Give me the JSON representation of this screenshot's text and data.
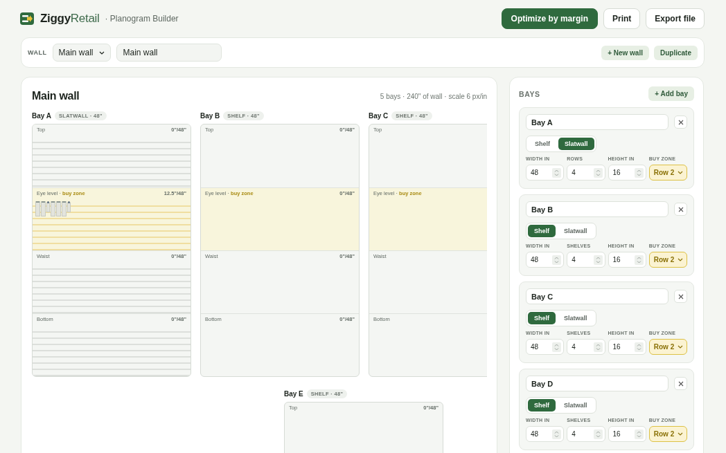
{
  "app": {
    "brand_bold": "Ziggy",
    "brand_light": "Retail",
    "subtitle": "· Planogram Builder"
  },
  "header_actions": [
    {
      "label": "Optimize by margin",
      "kind": "primary"
    },
    {
      "label": "Print",
      "kind": "secondary"
    },
    {
      "label": "Export file",
      "kind": "secondary"
    }
  ],
  "wall_bar": {
    "label": "WALL",
    "select": "Main wall",
    "name_value": "Main wall",
    "actions": [
      "+ New wall",
      "Duplicate"
    ]
  },
  "canvas": {
    "title": "Main wall",
    "meta": "5 bays · 240\" of wall · scale 6 px/in",
    "rows": [
      {
        "bays": [
          {
            "name": "Bay A",
            "kind": "slatwall",
            "tag": "SLATWALL · 48\"",
            "sections": [
              {
                "label": "Top",
                "fill": "0\"/48\"",
                "buy_zone": false
              },
              {
                "label": "Eye level ·",
                "zone_tag": "buy zone",
                "fill": "12.5\"/48\"",
                "buy_zone": true,
                "products": [
                  {
                    "kind": "box"
                  },
                  {
                    "kind": "box"
                  },
                  {
                    "kind": "can"
                  },
                  {
                    "kind": "box"
                  },
                  {
                    "kind": "box"
                  },
                  {
                    "kind": "box"
                  },
                  {
                    "kind": "can"
                  }
                ]
              },
              {
                "label": "Waist",
                "fill": "0\"/48\"",
                "buy_zone": false
              },
              {
                "label": "Bottom",
                "fill": "0\"/48\"",
                "buy_zone": false
              }
            ]
          },
          {
            "name": "Bay B",
            "kind": "shelf",
            "tag": "SHELF · 48\"",
            "sections": [
              {
                "label": "Top",
                "fill": "0\"/48\"",
                "buy_zone": false
              },
              {
                "label": "Eye level ·",
                "zone_tag": "buy zone",
                "fill": "0\"/48\"",
                "buy_zone": true
              },
              {
                "label": "Waist",
                "fill": "0\"/48\"",
                "buy_zone": false
              },
              {
                "label": "Bottom",
                "fill": "0\"/48\"",
                "buy_zone": false
              }
            ]
          },
          {
            "name": "Bay C",
            "kind": "shelf",
            "tag": "SHELF · 48\"",
            "sections": [
              {
                "label": "Top",
                "buy_zone": false
              },
              {
                "label": "Eye level ·",
                "zone_tag": "buy zone",
                "buy_zone": true
              },
              {
                "label": "Waist",
                "buy_zone": false
              },
              {
                "label": "Bottom",
                "buy_zone": false
              }
            ]
          }
        ]
      },
      {
        "bays": [
          {
            "name": "Bay E",
            "kind": "shelf",
            "tag": "SHELF · 48\"",
            "sections": [
              {
                "label": "Top",
                "fill": "0\"/48\"",
                "buy_zone": false
              }
            ]
          }
        ]
      }
    ]
  },
  "panel": {
    "title": "BAYS",
    "add": "+ Add bay",
    "bays": [
      {
        "name": "Bay A",
        "types": [
          {
            "label": "Shelf",
            "selected": false
          },
          {
            "label": "Slatwall",
            "selected": true
          }
        ],
        "fields": [
          {
            "label": "WIDTH IN",
            "value": "48",
            "kind": "number"
          },
          {
            "label": "ROWS",
            "value": "4",
            "kind": "number"
          },
          {
            "label": "HEIGHT IN",
            "value": "16",
            "kind": "number"
          },
          {
            "label": "BUY ZONE",
            "value": "Row 2",
            "kind": "select"
          }
        ]
      },
      {
        "name": "Bay B",
        "types": [
          {
            "label": "Shelf",
            "selected": true
          },
          {
            "label": "Slatwall",
            "selected": false
          }
        ],
        "fields": [
          {
            "label": "WIDTH IN",
            "value": "48",
            "kind": "number"
          },
          {
            "label": "SHELVES",
            "value": "4",
            "kind": "number"
          },
          {
            "label": "HEIGHT IN",
            "value": "16",
            "kind": "number"
          },
          {
            "label": "BUY ZONE",
            "value": "Row 2",
            "kind": "select"
          }
        ]
      },
      {
        "name": "Bay C",
        "types": [
          {
            "label": "Shelf",
            "selected": true
          },
          {
            "label": "Slatwall",
            "selected": false
          }
        ],
        "fields": [
          {
            "label": "WIDTH IN",
            "value": "48",
            "kind": "number"
          },
          {
            "label": "SHELVES",
            "value": "4",
            "kind": "number"
          },
          {
            "label": "HEIGHT IN",
            "value": "16",
            "kind": "number"
          },
          {
            "label": "BUY ZONE",
            "value": "Row 2",
            "kind": "select"
          }
        ]
      },
      {
        "name": "Bay D",
        "types": [
          {
            "label": "Shelf",
            "selected": true
          },
          {
            "label": "Slatwall",
            "selected": false
          }
        ],
        "fields": [
          {
            "label": "WIDTH IN",
            "value": "48",
            "kind": "number"
          },
          {
            "label": "SHELVES",
            "value": "4",
            "kind": "number"
          },
          {
            "label": "HEIGHT IN",
            "value": "16",
            "kind": "number"
          },
          {
            "label": "BUY ZONE",
            "value": "Row 2",
            "kind": "select"
          }
        ]
      }
    ]
  }
}
